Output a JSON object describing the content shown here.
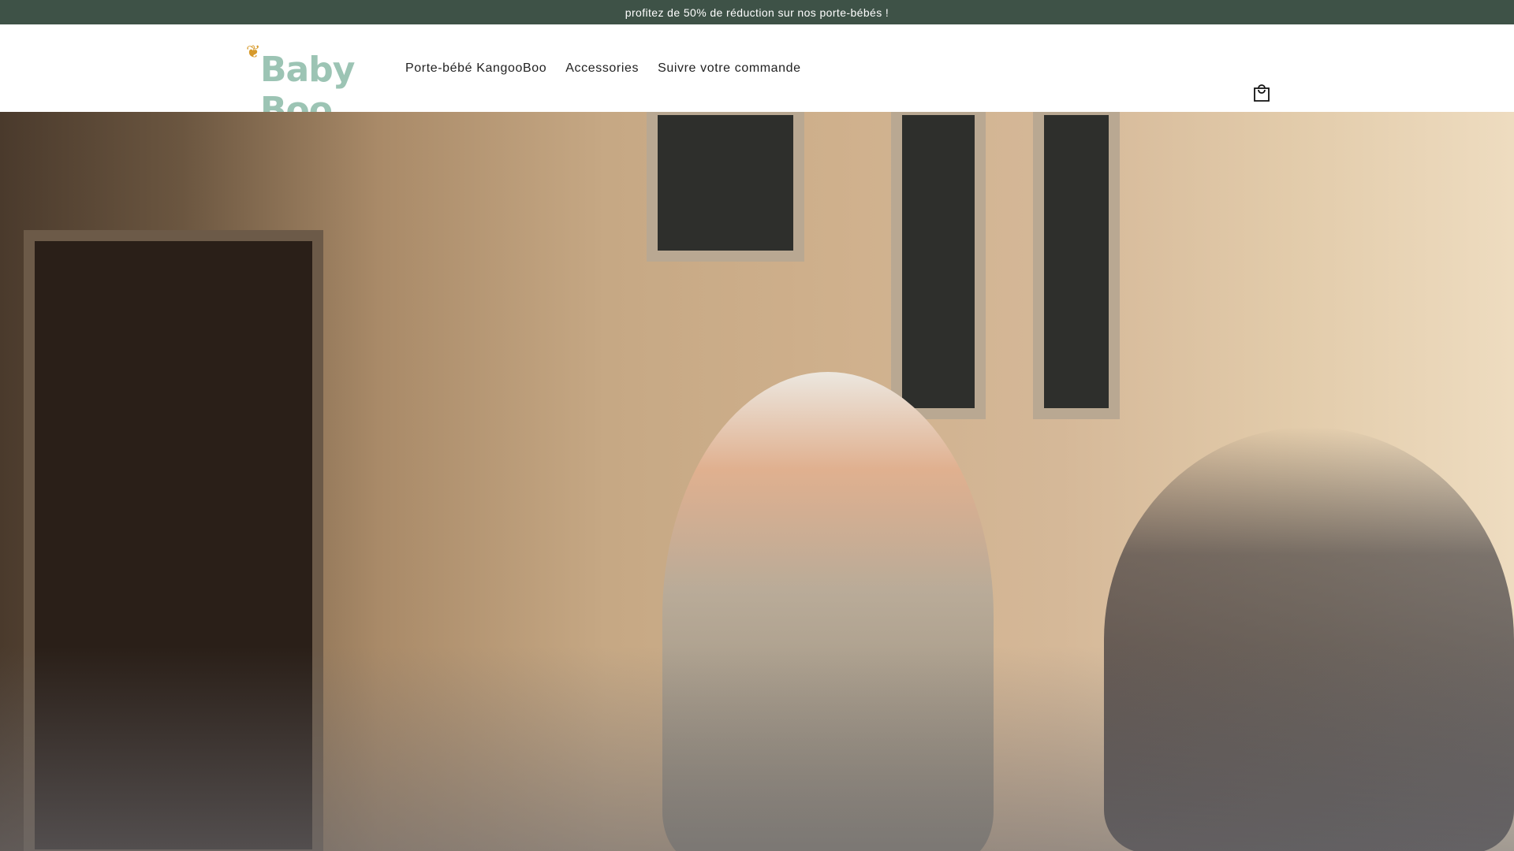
{
  "announcement": "profitez de 50% de réduction sur nos porte-bébés !",
  "logo": {
    "text": "Baby Boo"
  },
  "nav": [
    {
      "label": "Porte-bébé KangooBoo"
    },
    {
      "label": "Accessories"
    },
    {
      "label": "Suivre votre commande"
    }
  ],
  "cart": {
    "icon": "shopping-bag-icon"
  },
  "colors": {
    "banner": "#3e5247",
    "logo_green": "#9cc4b4",
    "logo_gold": "#d79a2b"
  }
}
